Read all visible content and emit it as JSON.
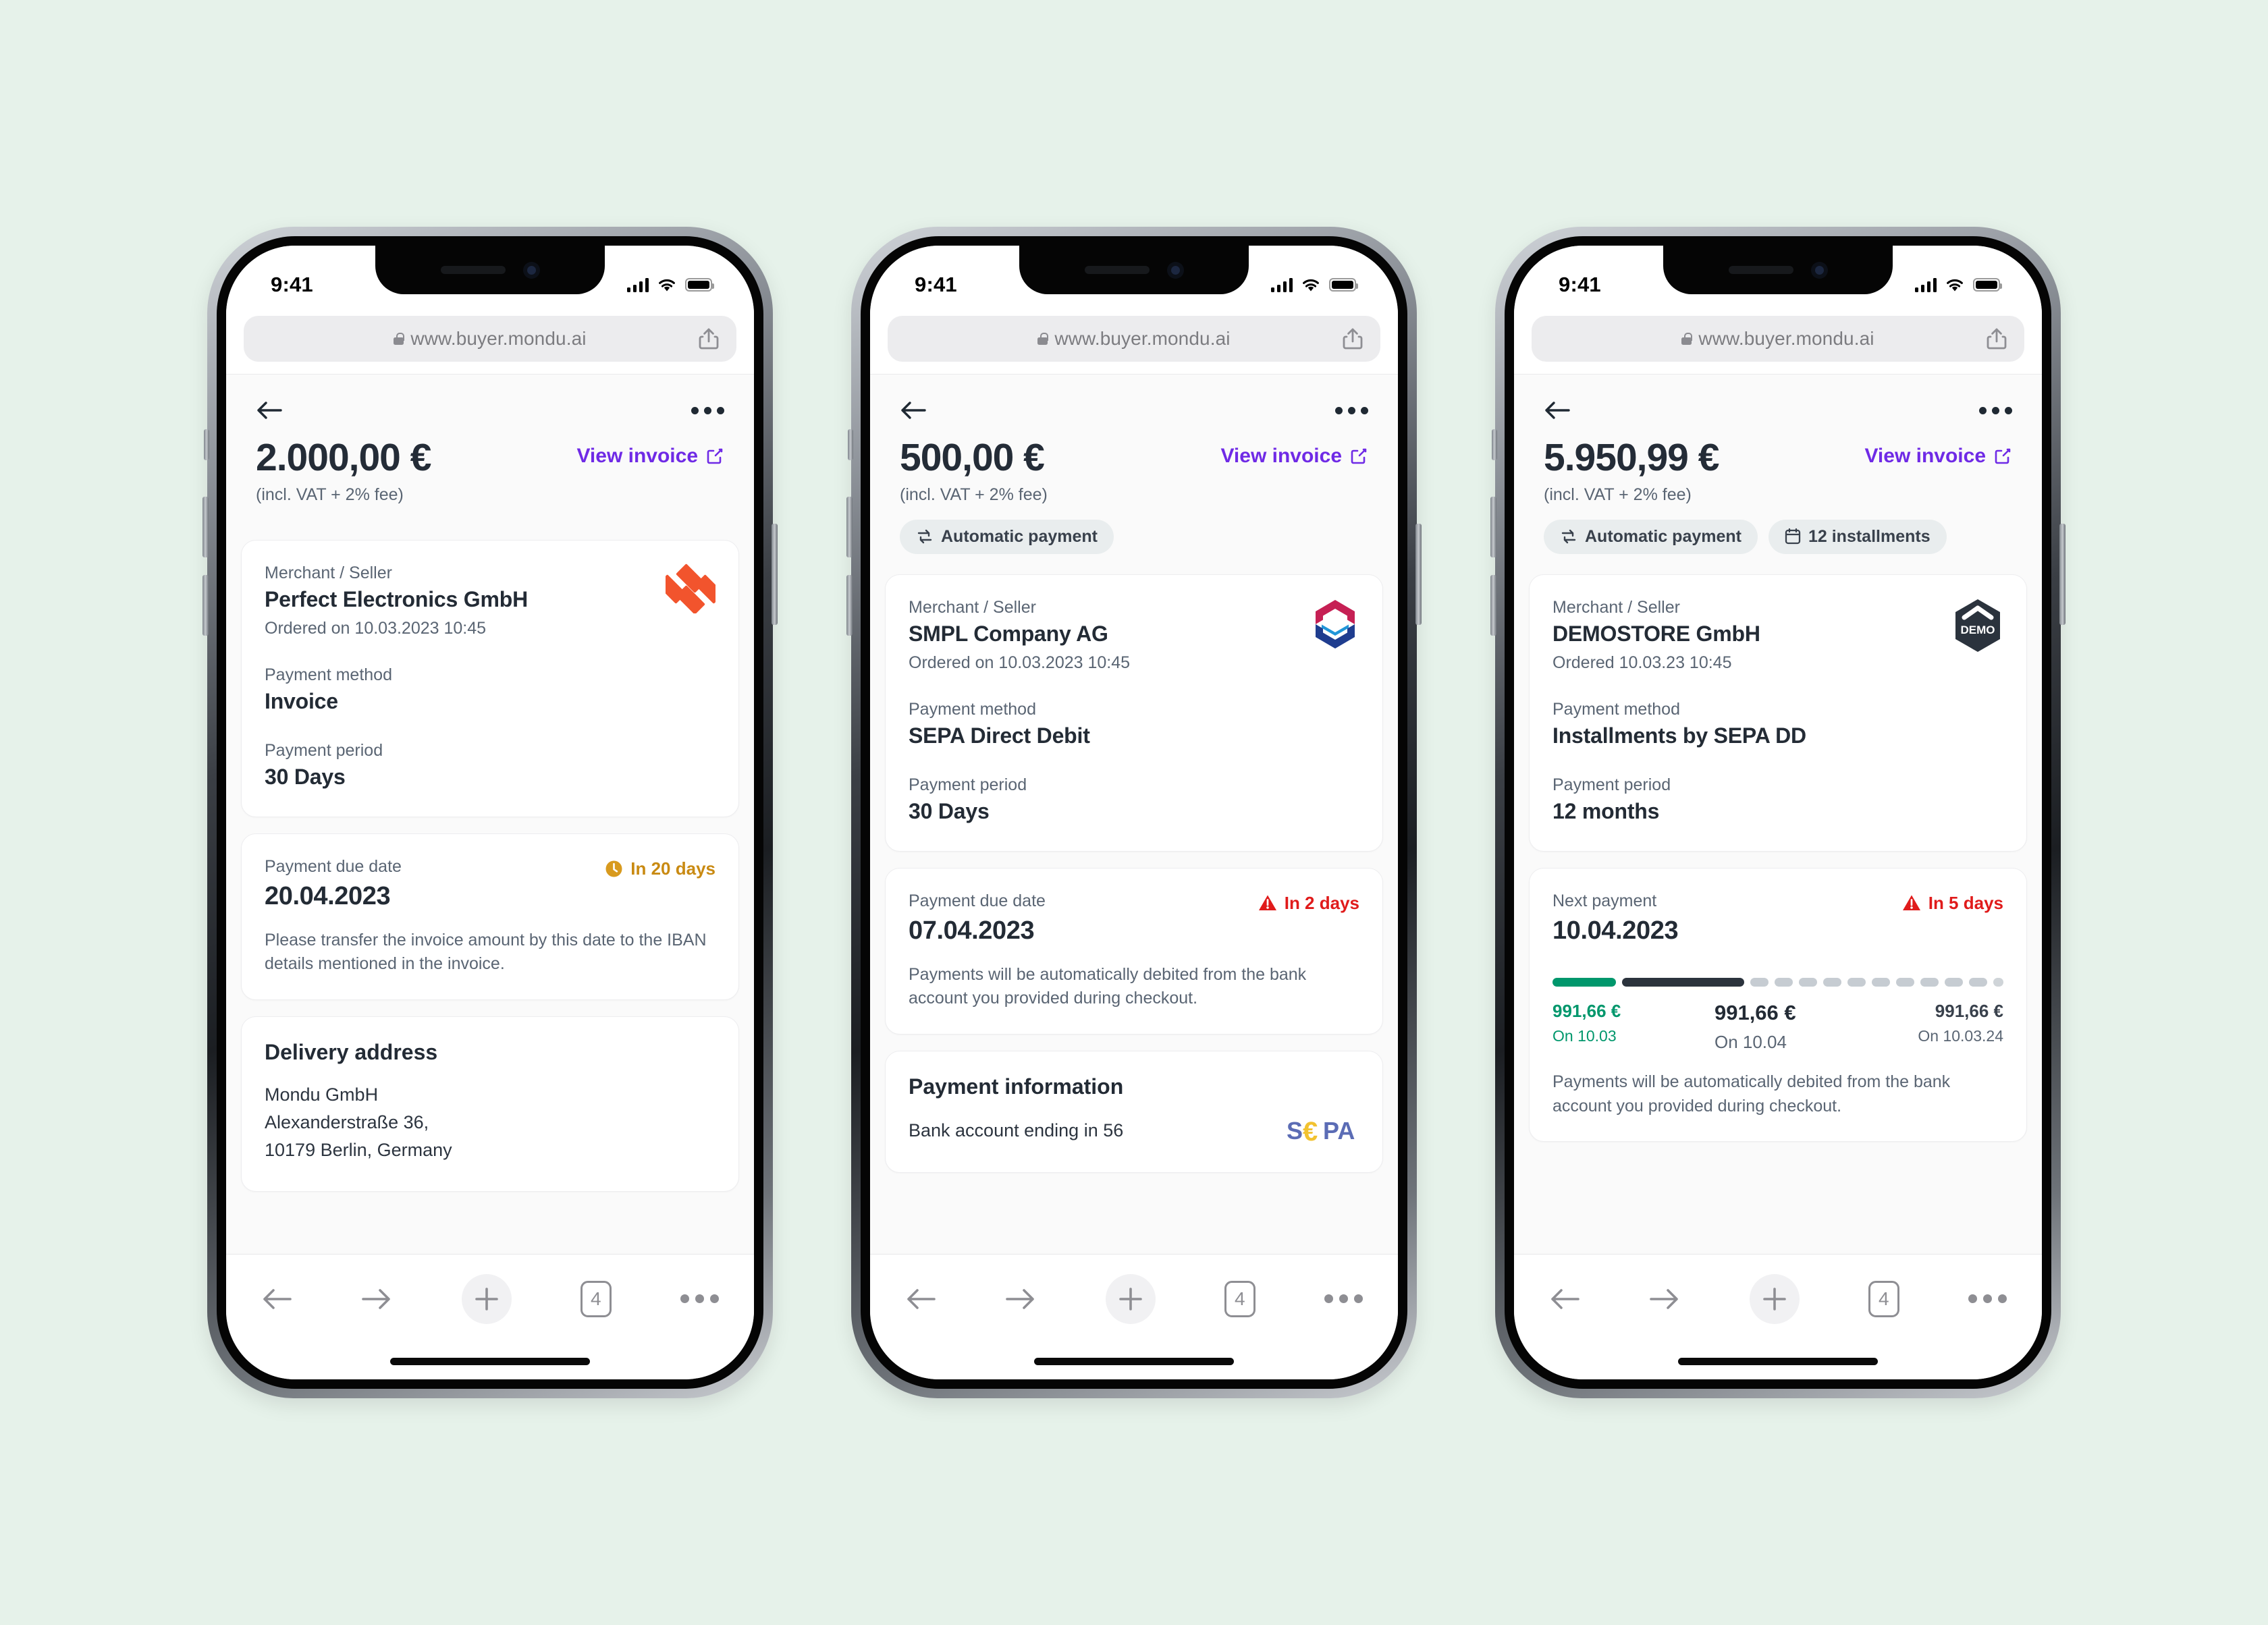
{
  "background_color": "#e6f2ea",
  "accent_color": "#6f2ae6",
  "browser": {
    "url": "www.buyer.mondu.ai",
    "lock_icon": "lock-icon",
    "share_icon": "share-icon",
    "back_icon": "arrow-left-icon",
    "forward_icon": "arrow-right-icon",
    "new_tab_icon": "plus-icon",
    "tab_count": "4",
    "more_icon": "more-dots-icon"
  },
  "status_bar": {
    "time": "9:41",
    "signal_icon": "cellular-signal-icon",
    "wifi_icon": "wifi-icon",
    "battery_icon": "battery-icon"
  },
  "phones": [
    {
      "id": "phone-invoice",
      "nav": {
        "back_icon": "arrow-left-icon",
        "more_icon": "more-dots-icon"
      },
      "hero": {
        "amount": "2.000,00 €",
        "vat_note": "(incl. VAT + 2% fee)",
        "view_invoice_label": "View invoice",
        "view_invoice_icon": "external-link-icon",
        "pills": []
      },
      "merchant": {
        "label": "Merchant / Seller",
        "name": "Perfect Electronics GmbH",
        "ordered": "Ordered on 10.03.2023 10:45",
        "logo": "perfect-electronics-logo",
        "payment_method_label": "Payment method",
        "payment_method": "Invoice",
        "payment_period_label": "Payment period",
        "payment_period": "30 Days"
      },
      "due": {
        "label": "Payment due date",
        "chip_text": "In 20 days",
        "chip_icon": "clock-icon",
        "chip_style": "warn",
        "date": "20.04.2023",
        "note": "Please transfer the invoice amount by this date to the IBAN details mentioned in the invoice."
      },
      "delivery": {
        "title": "Delivery address",
        "lines": [
          "Mondu GmbH",
          "Alexanderstraße 36,",
          "10179 Berlin, Germany"
        ]
      }
    },
    {
      "id": "phone-sepa",
      "nav": {
        "back_icon": "arrow-left-icon",
        "more_icon": "more-dots-icon"
      },
      "hero": {
        "amount": "500,00 €",
        "vat_note": "(incl. VAT + 2% fee)",
        "view_invoice_label": "View invoice",
        "view_invoice_icon": "external-link-icon",
        "pills": [
          {
            "label": "Automatic payment",
            "icon": "auto-repeat-icon"
          }
        ]
      },
      "merchant": {
        "label": "Merchant / Seller",
        "name": "SMPL Company AG",
        "ordered": "Ordered on 10.03.2023 10:45",
        "logo": "smpl-company-logo",
        "payment_method_label": "Payment method",
        "payment_method": "SEPA Direct Debit",
        "payment_period_label": "Payment period",
        "payment_period": "30 Days"
      },
      "due": {
        "label": "Payment due date",
        "chip_text": "In 2 days",
        "chip_icon": "alert-triangle-icon",
        "chip_style": "danger",
        "date": "07.04.2023",
        "note": "Payments will be automatically debited from the bank account you provided during checkout."
      },
      "payment_information": {
        "title": "Payment information",
        "account_text": "Bank account ending in 56",
        "logo": "sepa-logo"
      }
    },
    {
      "id": "phone-installments",
      "nav": {
        "back_icon": "arrow-left-icon",
        "more_icon": "more-dots-icon"
      },
      "hero": {
        "amount": "5.950,99 €",
        "vat_note": "(incl. VAT + 2% fee)",
        "view_invoice_label": "View invoice",
        "view_invoice_icon": "external-link-icon",
        "pills": [
          {
            "label": "Automatic payment",
            "icon": "auto-repeat-icon"
          },
          {
            "label": "12 installments",
            "icon": "calendar-icon"
          }
        ]
      },
      "merchant": {
        "label": "Merchant / Seller",
        "name": "DEMOSTORE GmbH",
        "ordered": "Ordered 10.03.23 10:45",
        "logo": "demostore-logo",
        "payment_method_label": "Payment method",
        "payment_method": "Installments by SEPA DD",
        "payment_period_label": "Payment period",
        "payment_period": "12 months"
      },
      "next_payment": {
        "label": "Next payment",
        "chip_text": "In 5 days",
        "chip_icon": "alert-triangle-icon",
        "chip_style": "danger",
        "date": "10.04.2023",
        "note": "Payments will be automatically debited from the bank account you provided during checkout."
      },
      "installments": {
        "paid_color": "#00976c",
        "next_color": "#2b333d",
        "pending_color": "#c6ccd2",
        "dot_count": 10,
        "markers": [
          {
            "amount": "991,66 €",
            "on": "On 10.03",
            "state": "paid"
          },
          {
            "amount": "991,66 €",
            "on": "On 10.04",
            "state": "next"
          },
          {
            "amount": "991,66 €",
            "on": "On 10.03.24",
            "state": "last"
          }
        ]
      }
    }
  ]
}
